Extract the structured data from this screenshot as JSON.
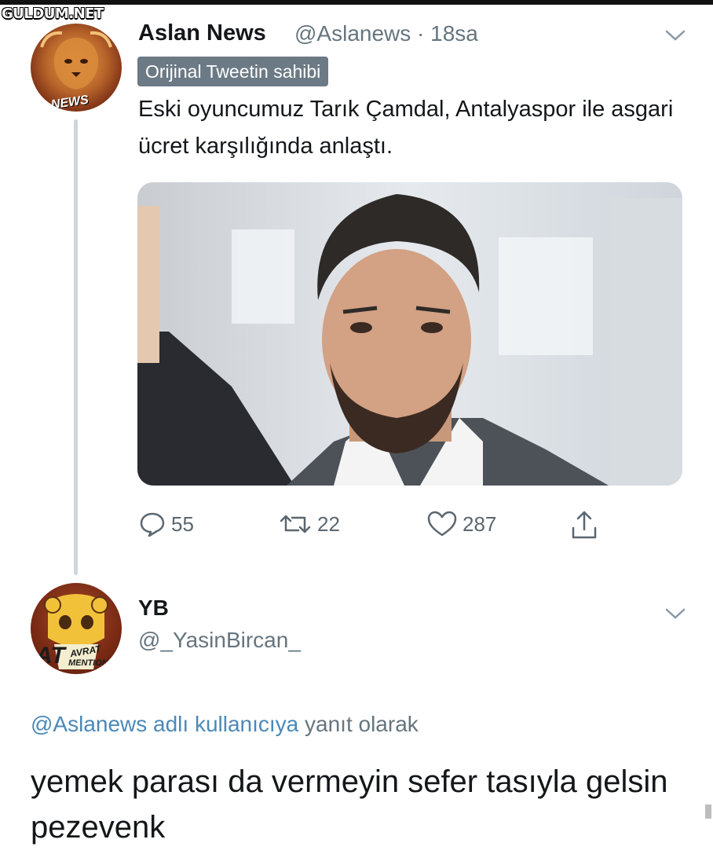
{
  "watermark": "GULDUM.NET",
  "tweet": {
    "author_name": "Aslan News",
    "handle_time": "@Aslanews · 18sa",
    "badge": "Orijinal Tweetin sahibi",
    "avatar_label": "NEWS",
    "text": "Eski oyuncumuz Tarık Çamdal, Antalyaspor ile asgari ücret karşılığında anlaştı.",
    "actions": {
      "replies": "55",
      "retweets": "22",
      "likes": "287"
    }
  },
  "reply": {
    "author_name": "YB",
    "handle": "@_YasinBircan_",
    "avatar_label_big": "AT",
    "avatar_label_small1": "AVRAT",
    "avatar_label_small2": "MENTION",
    "reply_to_mention": "@Aslanews adlı kullanıcıya",
    "reply_to_suffix": "yanıt olarak",
    "text": "yemek parası da vermeyin sefer tasıyla gelsin pezevenk"
  },
  "colors": {
    "text": "#14171a",
    "secondary": "#66757f",
    "mention": "#4b89b8",
    "badge_bg": "#6b7a85"
  }
}
